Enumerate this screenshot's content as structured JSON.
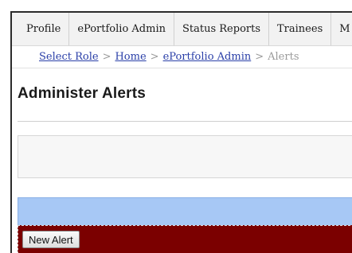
{
  "menu": {
    "items": [
      {
        "label": "Profile"
      },
      {
        "label": "ePortfolio Admin"
      },
      {
        "label": "Status Reports"
      },
      {
        "label": "Trainees"
      },
      {
        "label": "M"
      }
    ]
  },
  "breadcrumb": {
    "items": [
      {
        "label": "Select Role"
      },
      {
        "label": "Home"
      },
      {
        "label": "ePortfolio Admin"
      }
    ],
    "separator": ">",
    "current": "Alerts"
  },
  "page": {
    "title": "Administer Alerts"
  },
  "alerts_panel": {
    "new_button_label": "New Alert"
  },
  "colors": {
    "header_bar": "#a7c8f5",
    "panel_background": "#7b0000"
  }
}
